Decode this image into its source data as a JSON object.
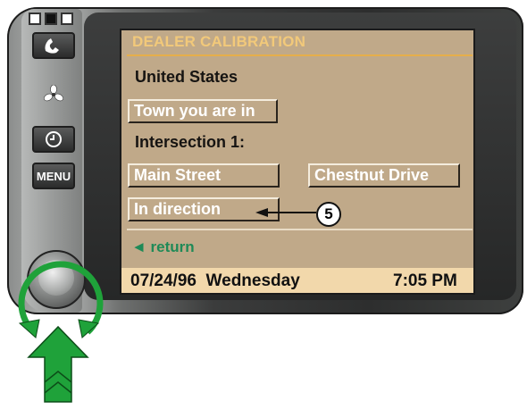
{
  "screen": {
    "title": "DEALER CALIBRATION",
    "country": "United States",
    "town_button": "Town you are in",
    "intersection_label": "Intersection 1:",
    "street1": "Main Street",
    "street2": "Chestnut Drive",
    "direction_button": "In direction",
    "return_label": "◄ return",
    "status": {
      "date": "07/24/96",
      "day": "Wednesday",
      "time": "7:05 PM"
    }
  },
  "device": {
    "menu_button": "MENU",
    "icons": [
      "phone-icon",
      "fan-icon",
      "clock-icon"
    ]
  },
  "annotation": {
    "callout": "5"
  },
  "colors": {
    "screen_bg": "#c0a989",
    "title": "#f2c97a",
    "return": "#1f8a57",
    "status_bg": "#f2d8ab",
    "arrow_green": "#1fa23a"
  }
}
